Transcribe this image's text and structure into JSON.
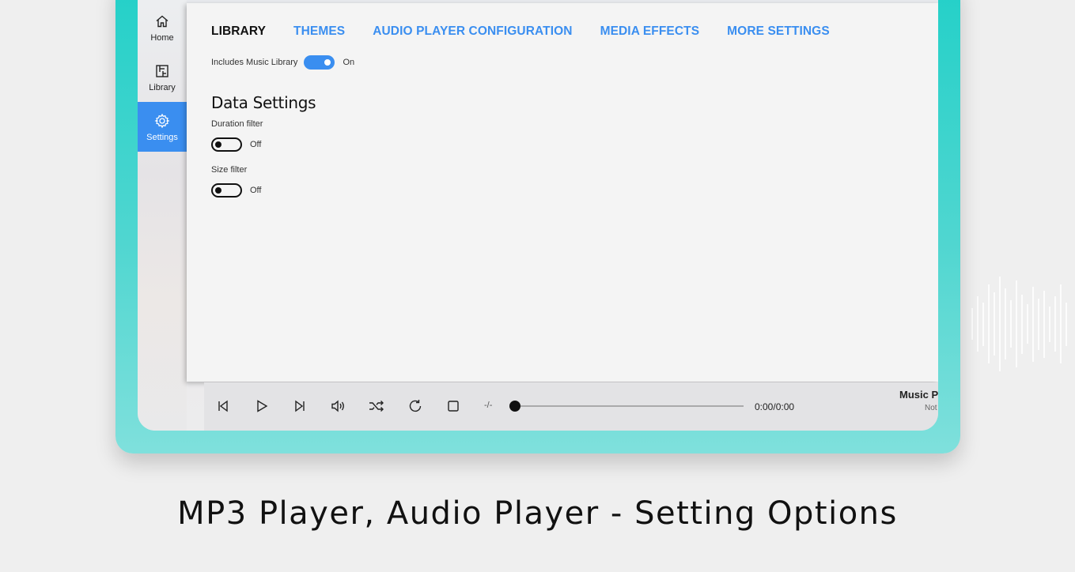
{
  "nav": {
    "items": [
      {
        "label": "Home",
        "icon": "home-icon"
      },
      {
        "label": "Library",
        "icon": "library-icon"
      },
      {
        "label": "Settings",
        "icon": "gear-icon"
      }
    ],
    "active": "Settings"
  },
  "tabs": [
    "LIBRARY",
    "THEMES",
    "AUDIO PLAYER CONFIGURATION",
    "MEDIA EFFECTS",
    "MORE SETTINGS"
  ],
  "active_tab": "LIBRARY",
  "library_toggle": {
    "label": "Includes Music Library",
    "state": "On"
  },
  "data_settings": {
    "title": "Data Settings",
    "duration_filter": {
      "label": "Duration filter",
      "state": "Off"
    },
    "size_filter": {
      "label": "Size filter",
      "state": "Off"
    }
  },
  "player": {
    "controls": [
      "previous-icon",
      "play-icon",
      "next-icon",
      "volume-icon",
      "shuffle-icon",
      "repeat-icon",
      "stop-icon"
    ],
    "rate": "-/-",
    "progress": 0,
    "time": "0:00/0:00",
    "now_playing_title": "Music P",
    "now_playing_sub": "Not"
  },
  "caption": "MP3 Player, Audio Player - Setting Options",
  "colors": {
    "accent": "#3a8ef0",
    "frame": "#2fd3cc",
    "background": "#efefef"
  }
}
